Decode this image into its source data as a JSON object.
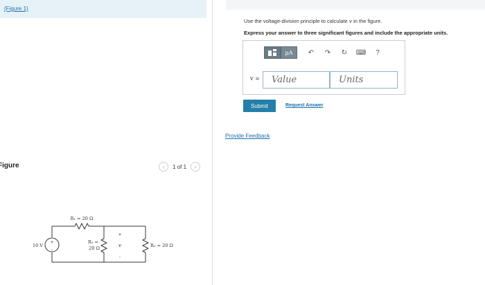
{
  "left_pane": {
    "figure_link": "(Figure 1)",
    "figure_heading": "Figure",
    "pager": {
      "text": "1 of 1",
      "prev": "‹",
      "next": "›"
    },
    "circuit": {
      "source_label": "10 V",
      "r1_label": "R₁ = 20 Ω",
      "r2_label_top": "R₂ =",
      "r2_label_bottom": "20 Ω",
      "r3_label": "R₃ = 20 Ω",
      "v_label": "v",
      "plus": "+",
      "minus": "-"
    }
  },
  "right_pane": {
    "instruction_prefix": "Use the voltage-division principle to calculate",
    "instruction_var": "v",
    "instruction_suffix": "in the figure.",
    "emphasis": "Express your answer to three significant figures and include the appropriate units.",
    "toolbar": {
      "units_label": "μA",
      "undo": "↶",
      "redo": "↷",
      "reset": "↻",
      "keyboard": "⌨",
      "help": "?"
    },
    "answer": {
      "var_label": "v =",
      "value_placeholder": "Value",
      "units_placeholder": "Units"
    },
    "submit_label": "Submit",
    "request_answer_label": "Request Answer",
    "feedback_label": "Provide Feedback"
  },
  "colors": {
    "accent": "#237fa9",
    "link": "#1a6fa8",
    "figure_bar": "#e6f2f7"
  }
}
